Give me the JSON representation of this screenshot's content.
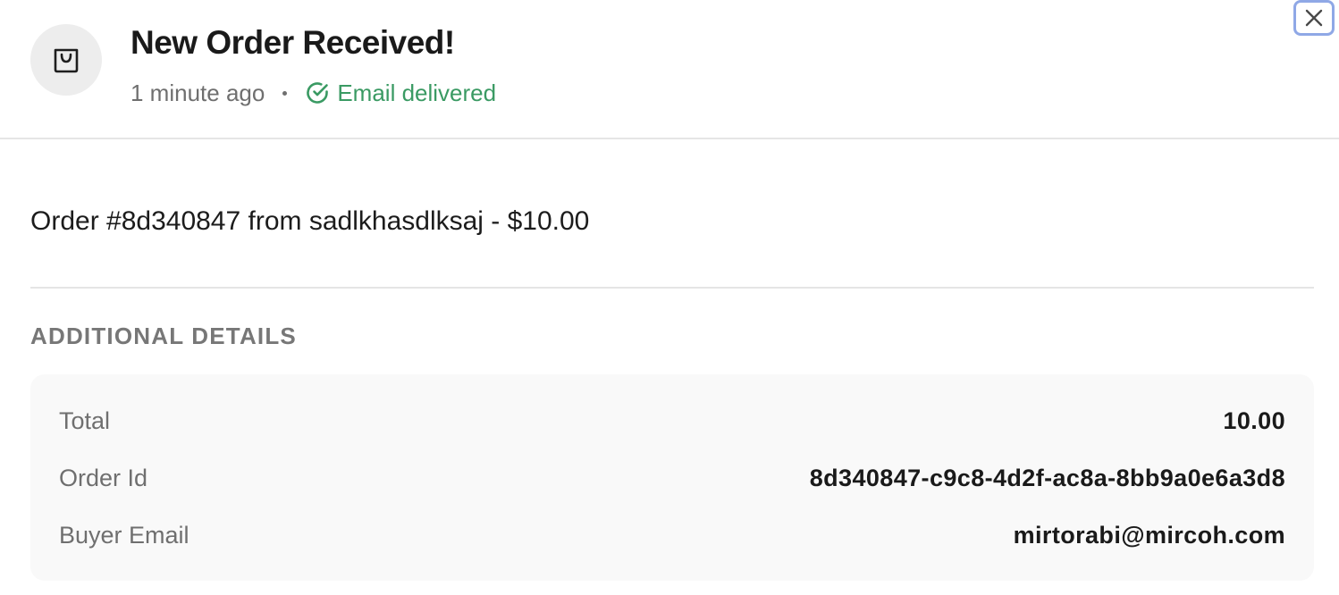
{
  "header": {
    "title": "New Order Received!",
    "timestamp": "1 minute ago",
    "separator": "•",
    "status_text": "Email delivered",
    "avatar_icon": "shopping-bag-icon",
    "status_icon": "check-circle-icon",
    "close_icon": "close-icon"
  },
  "summary": {
    "text": "Order #8d340847 from sadlkhasdlksaj - $10.00"
  },
  "details": {
    "heading": "ADDITIONAL DETAILS",
    "rows": [
      {
        "label": "Total",
        "value": "10.00"
      },
      {
        "label": "Order Id",
        "value": "8d340847-c9c8-4d2f-ac8a-8bb9a0e6a3d8"
      },
      {
        "label": "Buyer Email",
        "value": "mirtorabi@mircoh.com"
      }
    ]
  },
  "colors": {
    "status_green": "#3a9a63",
    "muted_text": "#6f6f6f",
    "close_focus_ring": "#8fa8e6",
    "avatar_bg": "#ededed",
    "details_bg": "#f9f9f9"
  }
}
